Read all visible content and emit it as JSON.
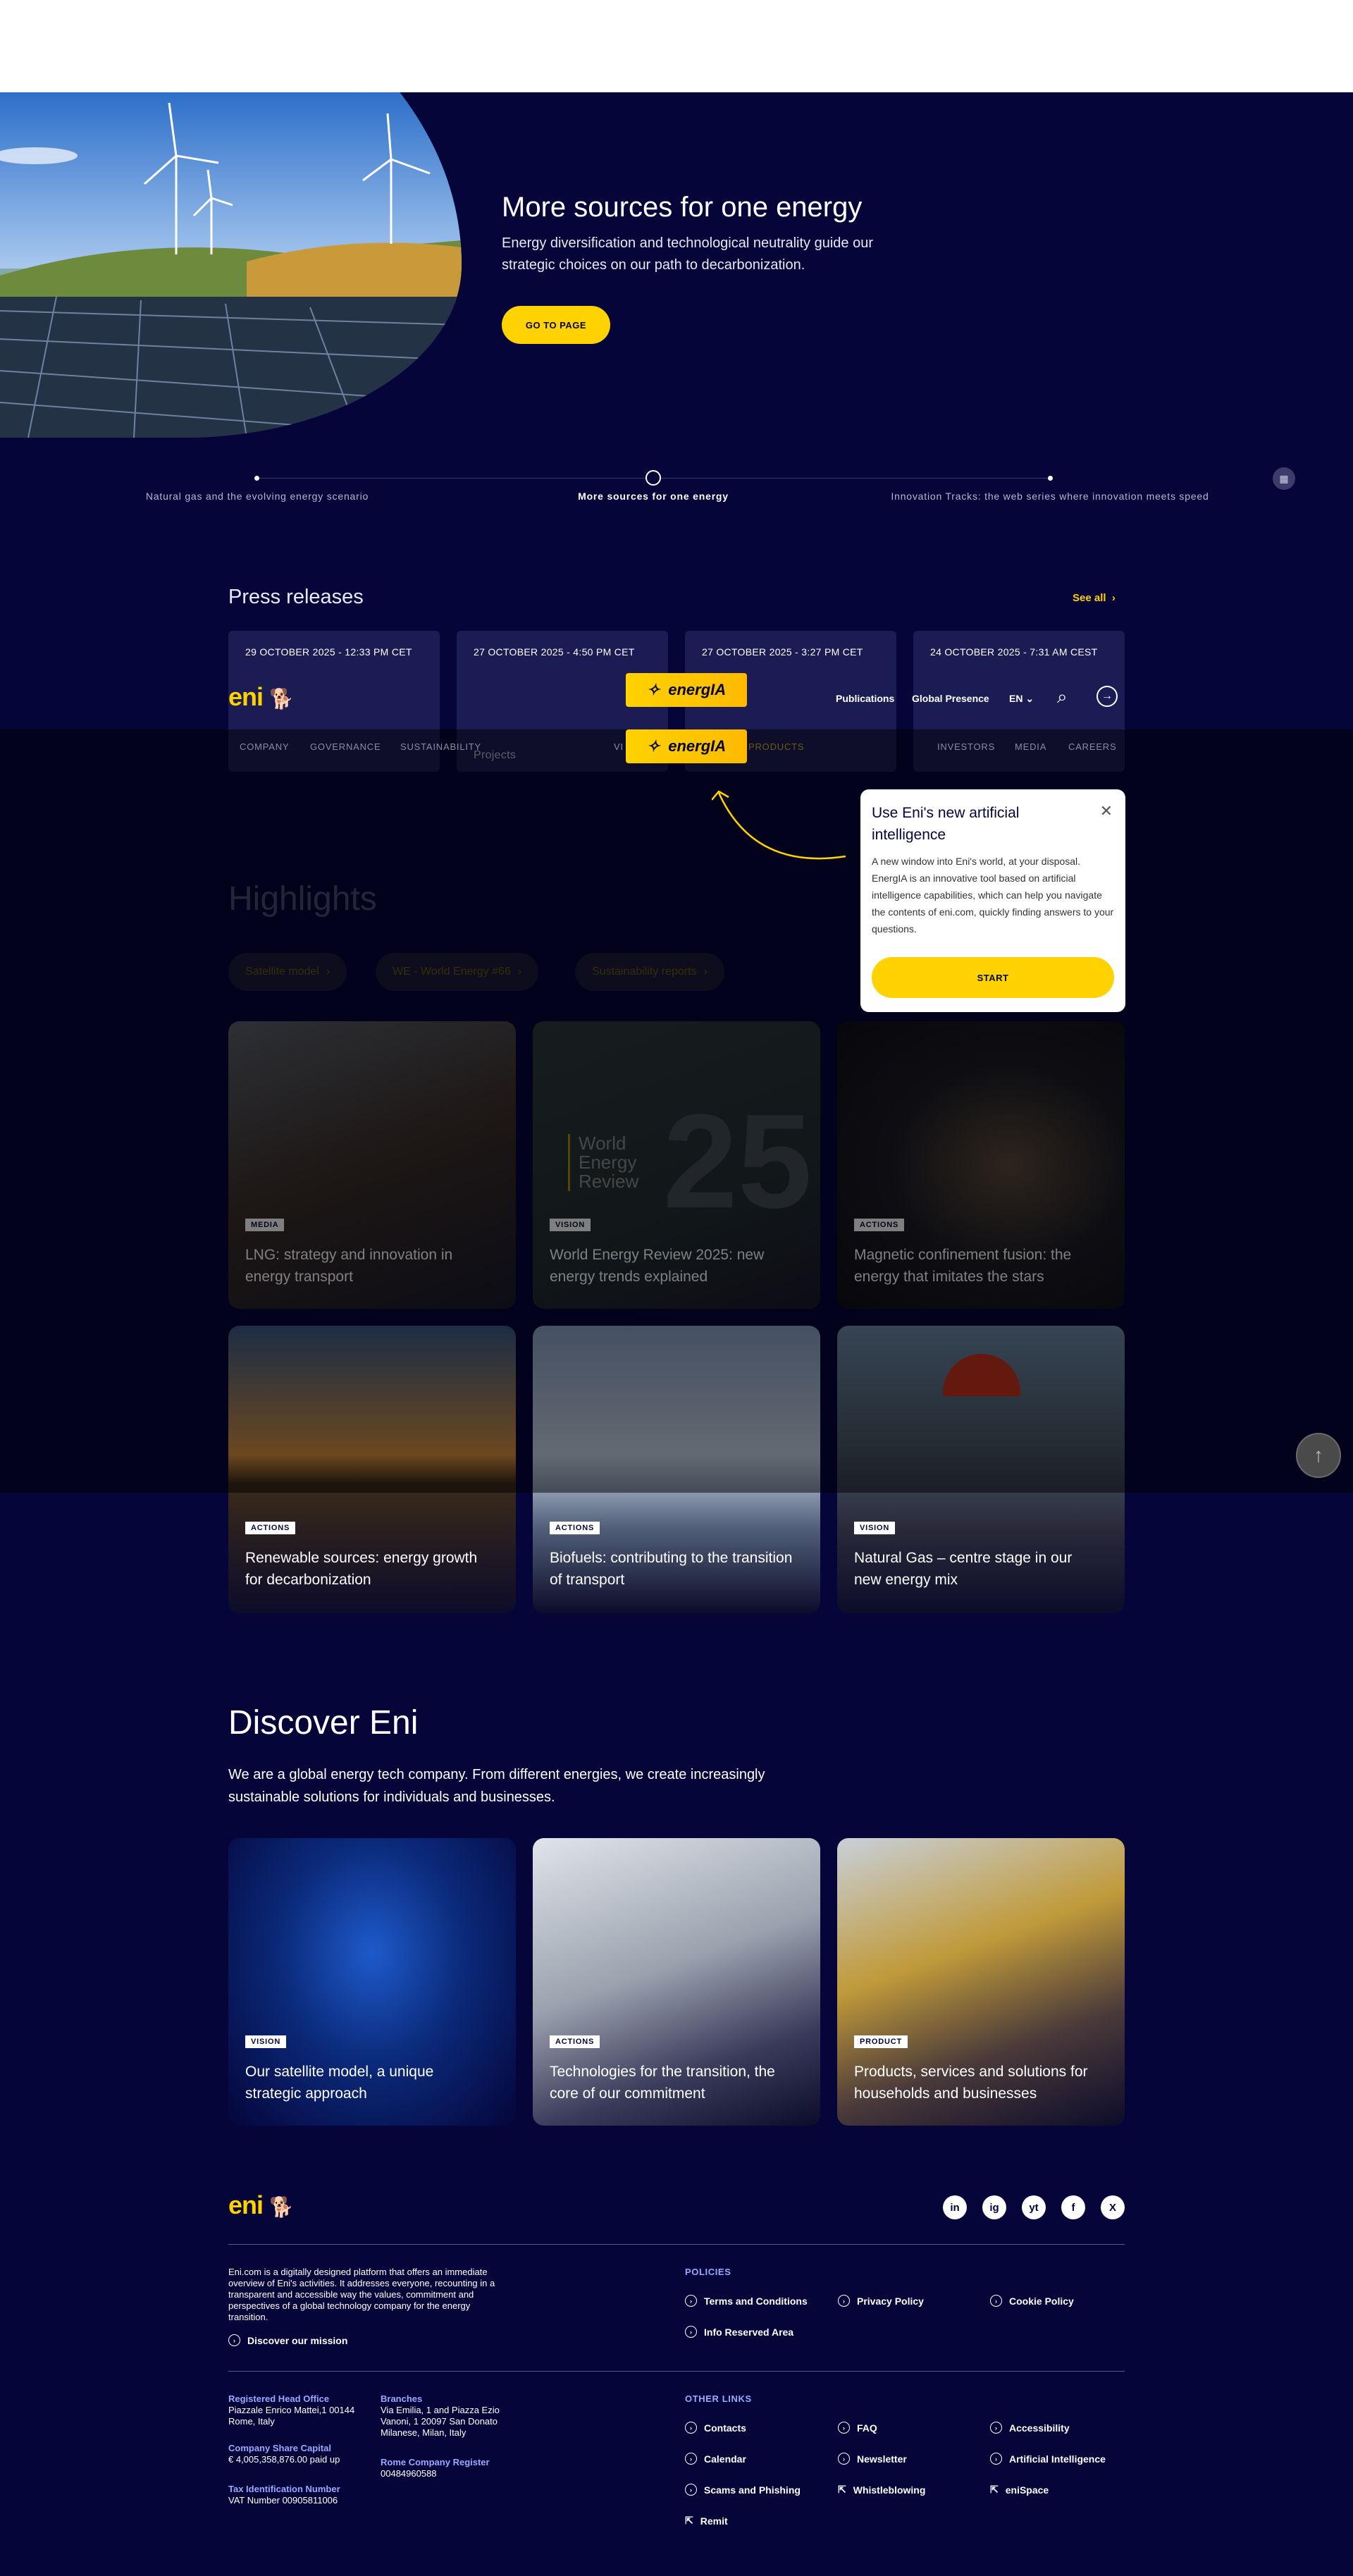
{
  "hero": {
    "title": "More sources for one energy",
    "desc": "Energy diversification and technological neutrality guide our strategic choices on our path to decarbonization.",
    "button": "GO TO PAGE"
  },
  "timeline": {
    "items": [
      "Natural gas and the evolving energy scenario",
      "More sources for one energy",
      "Innovation Tracks: the web series where innovation meets speed"
    ],
    "grid_icon": "grid-icon"
  },
  "press": {
    "title": "Press releases",
    "see_all": "See all",
    "cards": [
      {
        "date": "29 OCTOBER 2025 - 12:33 PM CET",
        "text": ""
      },
      {
        "date": "27 OCTOBER 2025 - 4:50 PM CET",
        "text": "Projects"
      },
      {
        "date": "27 OCTOBER 2025 - 3:27 PM CET",
        "text": ""
      },
      {
        "date": "24 OCTOBER 2025 - 7:31 AM CEST",
        "text": ""
      }
    ]
  },
  "nav": {
    "logo": "eni",
    "publications": "Publications",
    "global_presence": "Global Presence",
    "lang": "EN",
    "subnav": [
      "COMPANY",
      "GOVERNANCE",
      "SUSTAINABILITY",
      "VI",
      "PRODUCTS",
      "INVESTORS",
      "MEDIA",
      "CAREERS"
    ],
    "energia": "energIA"
  },
  "popup": {
    "title": "Use Eni's new artificial intelligence",
    "text": "A new window into Eni's world, at your disposal. EnergIA is an innovative tool based on artificial intelligence capabilities, which can help you navigate the contents of eni.com, quickly finding answers to your questions.",
    "button": "START"
  },
  "highlights": {
    "title": "Highlights",
    "chips": [
      "Satellite model",
      "WE - World Energy #66",
      "Sustainability reports"
    ],
    "cards": [
      {
        "tag": "MEDIA",
        "title": "LNG: strategy and innovation in energy transport"
      },
      {
        "tag": "VISION",
        "title": "World Energy Review 2025: new energy trends explained",
        "overlay": "World Energy Review"
      },
      {
        "tag": "ACTIONS",
        "title": "Magnetic confinement fusion: the energy that imitates the stars"
      },
      {
        "tag": "ACTIONS",
        "title": "Renewable sources: energy growth for decarbonization"
      },
      {
        "tag": "ACTIONS",
        "title": "Biofuels: contributing to the transition of transport"
      },
      {
        "tag": "VISION",
        "title": "Natural Gas – centre stage in our new energy mix"
      }
    ]
  },
  "discover": {
    "title": "Discover Eni",
    "desc": "We are a global energy tech company. From different energies, we create increasingly sustainable solutions for individuals and businesses.",
    "cards": [
      {
        "tag": "VISION",
        "title": "Our satellite model, a unique strategic approach"
      },
      {
        "tag": "ACTIONS",
        "title": "Technologies for the transition, the core of our commitment"
      },
      {
        "tag": "PRODUCT",
        "title": "Products, services and solutions for households and businesses"
      }
    ]
  },
  "footer": {
    "about": "Eni.com is a digitally designed platform that offers an immediate overview of Eni's activities. It addresses everyone, recounting in a transparent and accessible way the values, commitment and perspectives of a global technology company for the energy transition.",
    "mission": "Discover our mission",
    "policies_head": "POLICIES",
    "policies": [
      "Terms and Conditions",
      "Privacy Policy",
      "Cookie Policy",
      "Info Reserved Area"
    ],
    "other_head": "OTHER LINKS",
    "other": [
      "Contacts",
      "FAQ",
      "Accessibility",
      "Calendar",
      "Newsletter",
      "Artificial Intelligence",
      "Scams and Phishing",
      "Whistleblowing",
      "eniSpace",
      "Remit"
    ],
    "reg_office_label": "Registered Head Office",
    "reg_office": "Piazzale Enrico Mattei,1 00144 Rome, Italy",
    "branches_label": "Branches",
    "branches": "Via Emilia, 1 and Piazza Ezio Vanoni, 1 20097 San Donato Milanese, Milan, Italy",
    "capital_label": "Company Share Capital",
    "capital": "€ 4,005,358,876.00 paid up",
    "register_label": "Rome Company Register",
    "register": "00484960588",
    "tax_label": "Tax Identification Number",
    "tax": "VAT Number 00905811006",
    "social": [
      "in",
      "ig",
      "yt",
      "f",
      "X"
    ]
  }
}
